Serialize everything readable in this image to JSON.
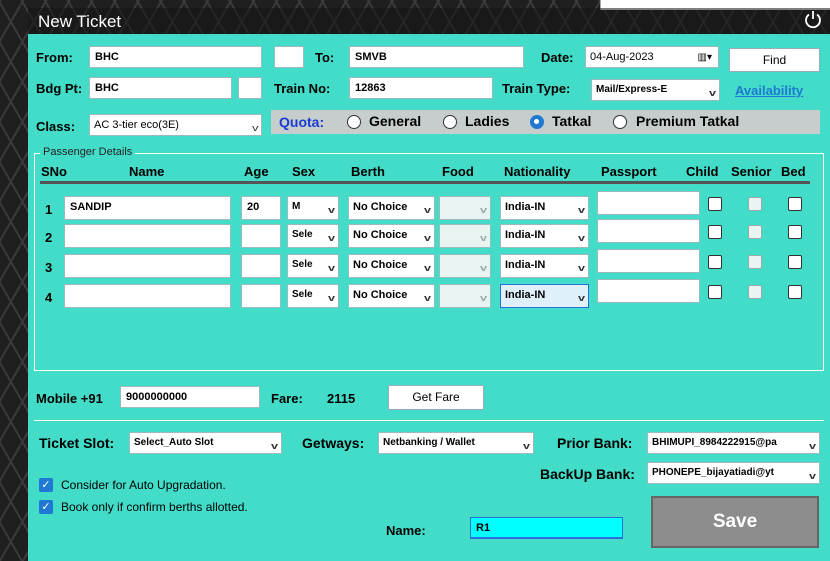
{
  "window": {
    "title": "New Ticket",
    "power_icon": "power-icon"
  },
  "header": {
    "from_label": "From:",
    "from_value": "BHC",
    "to_label": "To:",
    "to_value": "SMVB",
    "date_label": "Date:",
    "date_value": "04-Aug-2023",
    "find_label": "Find",
    "bdg_label": "Bdg Pt:",
    "bdg_value": "BHC",
    "train_no_label": "Train No:",
    "train_no_value": "12863",
    "train_type_label": "Train Type:",
    "train_type_value": "Mail/Express-E",
    "availability_label": "Availability",
    "class_label": "Class:",
    "class_value": "AC 3-tier eco(3E)",
    "quota_label": "Quota:",
    "quota_options": [
      "General",
      "Ladies",
      "Tatkal",
      "Premium Tatkal"
    ],
    "quota_selected": "Tatkal"
  },
  "passengers": {
    "legend": "Passenger Details",
    "columns": [
      "SNo",
      "Name",
      "Age",
      "Sex",
      "Berth",
      "Food",
      "Nationality",
      "Passport",
      "Child",
      "Senior",
      "Bed"
    ],
    "rows": [
      {
        "sno": "1",
        "name": "SANDIP",
        "age": "20",
        "sex": "M",
        "berth": "No Choice",
        "food": "",
        "nationality": "India-IN",
        "passport": ""
      },
      {
        "sno": "2",
        "name": "",
        "age": "",
        "sex": "Sele",
        "berth": "No Choice",
        "food": "",
        "nationality": "India-IN",
        "passport": ""
      },
      {
        "sno": "3",
        "name": "",
        "age": "",
        "sex": "Sele",
        "berth": "No Choice",
        "food": "",
        "nationality": "India-IN",
        "passport": ""
      },
      {
        "sno": "4",
        "name": "",
        "age": "",
        "sex": "Sele",
        "berth": "No Choice",
        "food": "",
        "nationality": "India-IN",
        "passport": ""
      }
    ]
  },
  "contact": {
    "mobile_label": "Mobile +91",
    "mobile_value": "9000000000",
    "fare_label": "Fare:",
    "fare_value": "2115",
    "get_fare_label": "Get Fare"
  },
  "payment": {
    "ticket_slot_label": "Ticket Slot:",
    "ticket_slot_value": "Select_Auto Slot",
    "getways_label": "Getways:",
    "getways_value": "Netbanking / Wallet",
    "prior_bank_label": "Prior Bank:",
    "prior_bank_value": "BHIMUPI_8984222915@pa",
    "backup_bank_label": "BackUp Bank:",
    "backup_bank_value": "PHONEPE_bijayatiadi@yt",
    "auto_upgrade_label": "Consider for Auto Upgradation.",
    "confirm_berths_label": "Book only if confirm berths allotted.",
    "name_label": "Name:",
    "name_value": "R1",
    "save_label": "Save"
  },
  "colors": {
    "panel": "#42dcc9",
    "accent": "#1f78d1",
    "quota_bar": "#c7cdcc"
  }
}
